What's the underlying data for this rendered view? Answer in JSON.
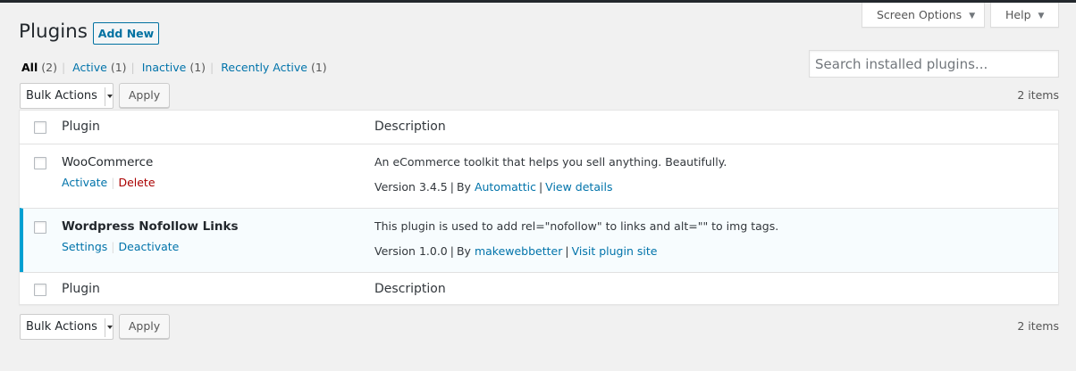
{
  "screen_meta": {
    "screen_options_label": "Screen Options",
    "help_label": "Help"
  },
  "page": {
    "title": "Plugins",
    "add_new_label": "Add New"
  },
  "filters": {
    "all": {
      "label": "All",
      "count": "(2)"
    },
    "active": {
      "label": "Active",
      "count": "(1)"
    },
    "inactive": {
      "label": "Inactive",
      "count": "(1)"
    },
    "recently_active": {
      "label": "Recently Active",
      "count": "(1)"
    }
  },
  "search": {
    "placeholder": "Search installed plugins..."
  },
  "bulk_top": {
    "selected": "Bulk Actions",
    "apply_label": "Apply",
    "items_count": "2 items"
  },
  "bulk_bottom": {
    "selected": "Bulk Actions",
    "apply_label": "Apply",
    "items_count": "2 items"
  },
  "table": {
    "columns": [
      "Plugin",
      "Description"
    ],
    "plugins": [
      {
        "name": "WooCommerce",
        "active": false,
        "actions": [
          "Activate",
          "Delete"
        ],
        "description": "An eCommerce toolkit that helps you sell anything. Beautifully.",
        "version": "Version 3.4.5",
        "by_label": "By",
        "author": "Automattic",
        "extra_link": "View details"
      },
      {
        "name": "Wordpress Nofollow Links",
        "active": true,
        "actions": [
          "Settings",
          "Deactivate"
        ],
        "description": "This plugin is used to add rel=\"nofollow\" to links and alt=\"\" to img tags.",
        "version": "Version 1.0.0",
        "by_label": "By",
        "author": "makewebbetter",
        "extra_link": "Visit plugin site"
      }
    ]
  },
  "colors": {
    "link": "#0073aa",
    "delete": "#aa0000",
    "active_border": "#00a0d2",
    "active_row_bg": "#f7fcfe"
  }
}
